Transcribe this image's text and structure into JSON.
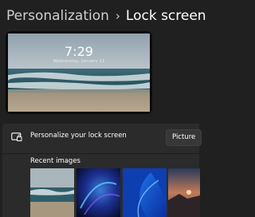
{
  "breadcrumb": {
    "parent": "Personalization",
    "separator": "›",
    "current": "Lock screen"
  },
  "preview": {
    "time": "7:29",
    "date": "Wednesday, January 11"
  },
  "settings": {
    "personalize_label": "Personalize your lock screen",
    "personalize_value": "Picture",
    "recent_images_label": "Recent images",
    "recent_images": [
      "beach-waves",
      "blue-swirl",
      "blue-bloom",
      "sunset-rocks"
    ]
  },
  "colors": {
    "background": "#202020",
    "card": "#2b2b2b",
    "accent": "#0067c0"
  }
}
